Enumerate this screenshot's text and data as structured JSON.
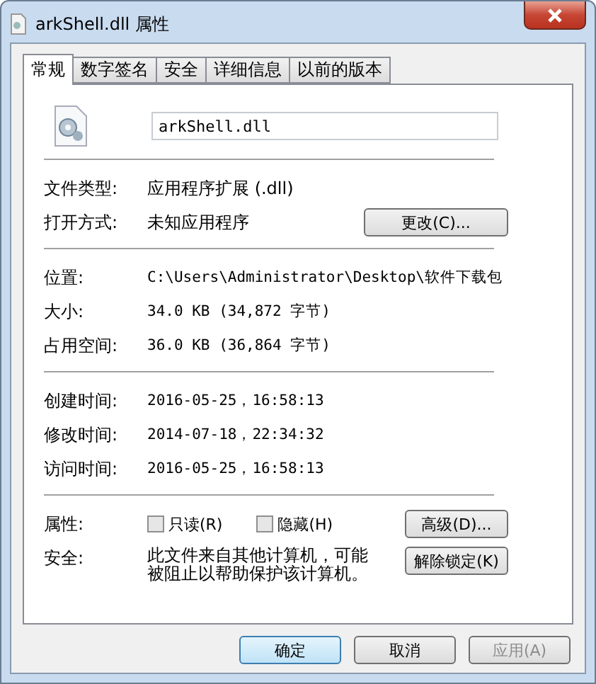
{
  "window": {
    "title": "arkShell.dll 属性"
  },
  "tabs": [
    {
      "label": "常规",
      "selected": true
    },
    {
      "label": "数字签名",
      "selected": false
    },
    {
      "label": "安全",
      "selected": false
    },
    {
      "label": "详细信息",
      "selected": false
    },
    {
      "label": "以前的版本",
      "selected": false
    }
  ],
  "file_name": {
    "value": "arkShell.dll"
  },
  "type_section": [
    {
      "label": "文件类型:",
      "value": "应用程序扩展 (.dll)"
    },
    {
      "label": "打开方式:",
      "value": "未知应用程序",
      "button": "更改(C)..."
    }
  ],
  "location_section": [
    {
      "label": "位置:",
      "value": "C:\\Users\\Administrator\\Desktop\\软件下载包"
    },
    {
      "label": "大小:",
      "value": "34.0 KB (34,872 字节)"
    },
    {
      "label": "占用空间:",
      "value": "36.0 KB (36,864 字节)"
    }
  ],
  "time_section": [
    {
      "label": "创建时间:",
      "value": "2016-05-25，16:58:13"
    },
    {
      "label": "修改时间:",
      "value": "2014-07-18，22:34:32"
    },
    {
      "label": "访问时间:",
      "value": "2016-05-25，16:58:13"
    }
  ],
  "attributes": {
    "label": "属性:",
    "checkboxes": [
      {
        "label": "只读(R)",
        "checked": false
      },
      {
        "label": "隐藏(H)",
        "checked": false
      }
    ],
    "button": "高级(D)..."
  },
  "security": {
    "label": "安全:",
    "text": "此文件来自其他计算机，可能被阻止以帮助保护该计算机。",
    "button": "解除锁定(K)"
  },
  "buttons": [
    {
      "label": "确定",
      "kind": "default",
      "disabled": false
    },
    {
      "label": "取消",
      "kind": "normal",
      "disabled": false
    },
    {
      "label": "应用(A)",
      "kind": "normal",
      "disabled": true
    }
  ]
}
